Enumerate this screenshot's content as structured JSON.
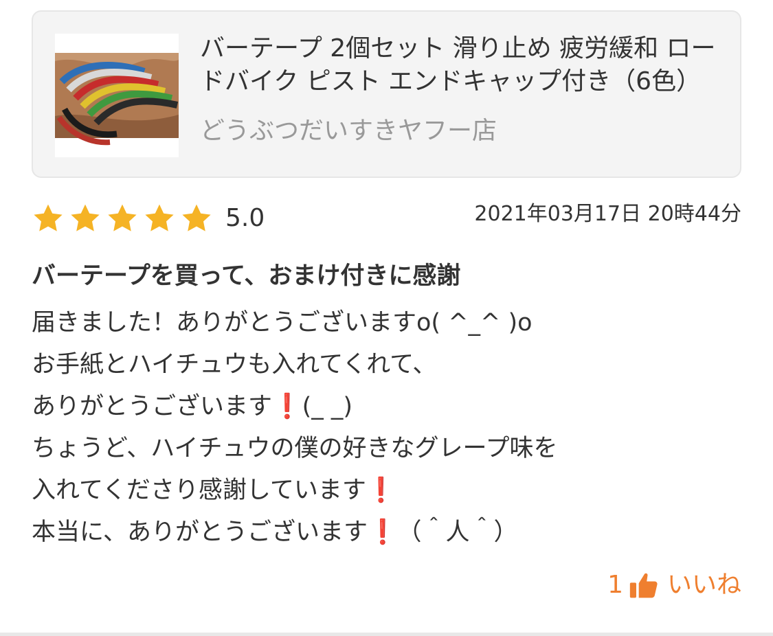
{
  "product": {
    "title": "バーテープ 2個セット 滑り止め 疲労緩和 ロードバイク ピスト エンドキャップ付き（6色）",
    "shop": "どうぶつだいすきヤフー店",
    "thumbnail_icon": "bar-tape-product-photo"
  },
  "review": {
    "rating": 5,
    "rating_text": "5.0",
    "date": "2021年03月17日 20時44分",
    "title": "バーテープを買って、おまけ付きに感謝",
    "lines": [
      "届きました！ありがとうございますo( ^_^ )o",
      "お手紙とハイチュウも入れてくれて、",
      "ありがとうございます❗️(_ _)",
      "ちょうど、ハイチュウの僕の好きなグレープ味を",
      "入れてくださり感謝しています❗️",
      "本当に、ありがとうございます❗️（＾人＾）"
    ]
  },
  "like": {
    "count": "1",
    "label": "いいね",
    "icon": "thumbs-up-icon"
  },
  "colors": {
    "star": "#f5b325",
    "accent": "#ef7f2f",
    "card_bg": "#f4f4f4",
    "muted_text": "#999999"
  }
}
